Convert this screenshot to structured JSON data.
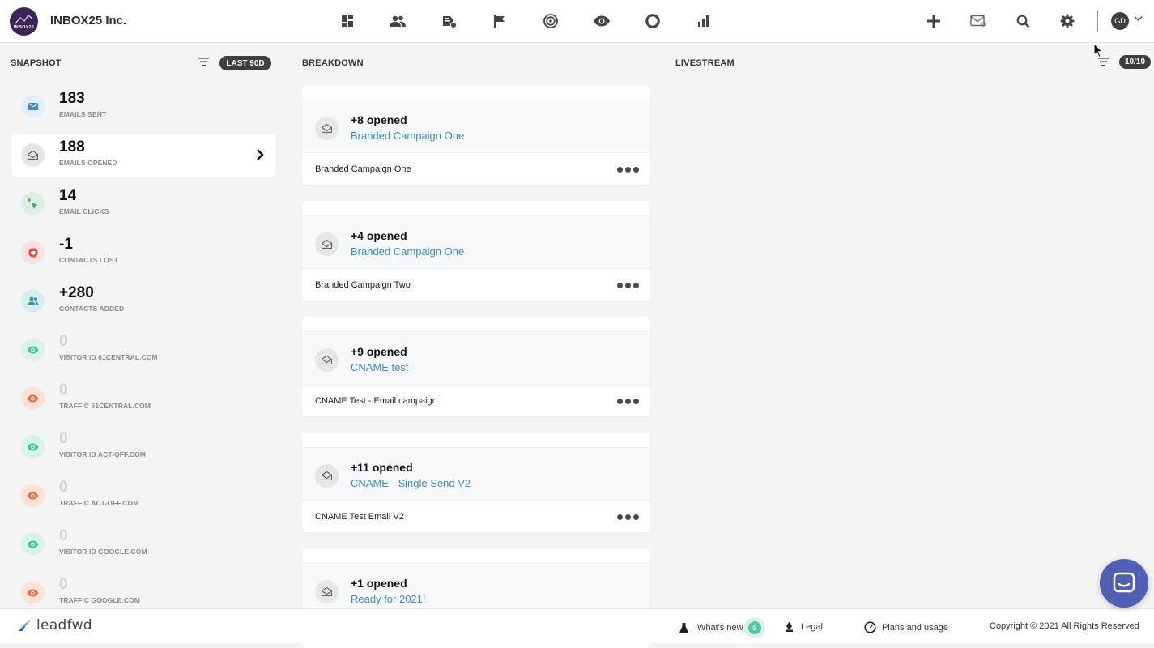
{
  "header": {
    "company": "INBOX25 Inc.",
    "logo_text": "INBOX25",
    "nav_icons": [
      "dashboard-icon",
      "contacts-icon",
      "campaigns-icon",
      "flag-icon",
      "target-icon",
      "eye-icon",
      "circle-icon",
      "reports-icon"
    ],
    "action_icons": [
      "add-icon",
      "mail-icon",
      "search-icon",
      "gear-icon"
    ],
    "avatar_initials": "GD"
  },
  "snapshot": {
    "title": "SNAPSHOT",
    "range": "LAST 90D",
    "stats": [
      {
        "value": "183",
        "label": "EMAILS SENT",
        "icon": "envelope-icon",
        "color": "#3b8cc4",
        "bg": "#e3eef8"
      },
      {
        "value": "188",
        "label": "EMAILS OPENED",
        "icon": "open-envelope-icon",
        "color": "#666666",
        "bg": "#e6e6e6"
      },
      {
        "value": "14",
        "label": "EMAIL CLICKS",
        "icon": "cursor-click-icon",
        "color": "#3aa76d",
        "bg": "#dcefe4"
      },
      {
        "value": "-1",
        "label": "CONTACTS LOST",
        "icon": "stop-hand-icon",
        "color": "#e84a4a",
        "bg": "#fbe1e1"
      },
      {
        "value": "+280",
        "label": "CONTACTS ADDED",
        "icon": "users-icon",
        "color": "#2c9aa0",
        "bg": "#d8eeee"
      },
      {
        "value": "0",
        "label": "VISITOR ID 61CENTRAL.COM",
        "icon": "eye-icon",
        "color": "#3cc3a0",
        "bg": "#d9f3ec"
      },
      {
        "value": "0",
        "label": "TRAFFIC 61CENTRAL.COM",
        "icon": "eye-icon",
        "color": "#f06a3a",
        "bg": "#fce3d8"
      },
      {
        "value": "0",
        "label": "VISITOR ID ACT-OFF.COM",
        "icon": "eye-icon",
        "color": "#3cc3a0",
        "bg": "#d9f3ec"
      },
      {
        "value": "0",
        "label": "TRAFFIC ACT-OFF.COM",
        "icon": "eye-icon",
        "color": "#f06a3a",
        "bg": "#fce3d8"
      },
      {
        "value": "0",
        "label": "VISITOR ID GOOGLE.COM",
        "icon": "eye-icon",
        "color": "#3cc3a0",
        "bg": "#d9f3ec"
      },
      {
        "value": "0",
        "label": "TRAFFIC GOOGLE.COM",
        "icon": "eye-icon",
        "color": "#f06a3a",
        "bg": "#fce3d8"
      }
    ]
  },
  "breakdown": {
    "title": "BREAKDOWN",
    "cards": [
      {
        "headline": "+8 opened",
        "link": "Branded Campaign One",
        "footer": "Branded Campaign One"
      },
      {
        "headline": "+4 opened",
        "link": "Branded Campaign One",
        "footer": "Branded Campaign Two"
      },
      {
        "headline": "+9 opened",
        "link": "CNAME test",
        "footer": "CNAME Test - Email campaign"
      },
      {
        "headline": "+11 opened",
        "link": "CNAME - Single Send V2",
        "footer": "CNAME Test Email V2"
      },
      {
        "headline": "+1 opened",
        "link": "Ready for 2021!",
        "footer": ""
      }
    ]
  },
  "livestream": {
    "title": "LIVESTREAM",
    "count": "10/10"
  },
  "footer": {
    "brand": "leadfwd",
    "whats_new": "What's new",
    "new_badge": "5",
    "legal": "Legal",
    "plans": "Plans and usage",
    "copyright": "Copyright © 2021 All Rights Reserved"
  }
}
